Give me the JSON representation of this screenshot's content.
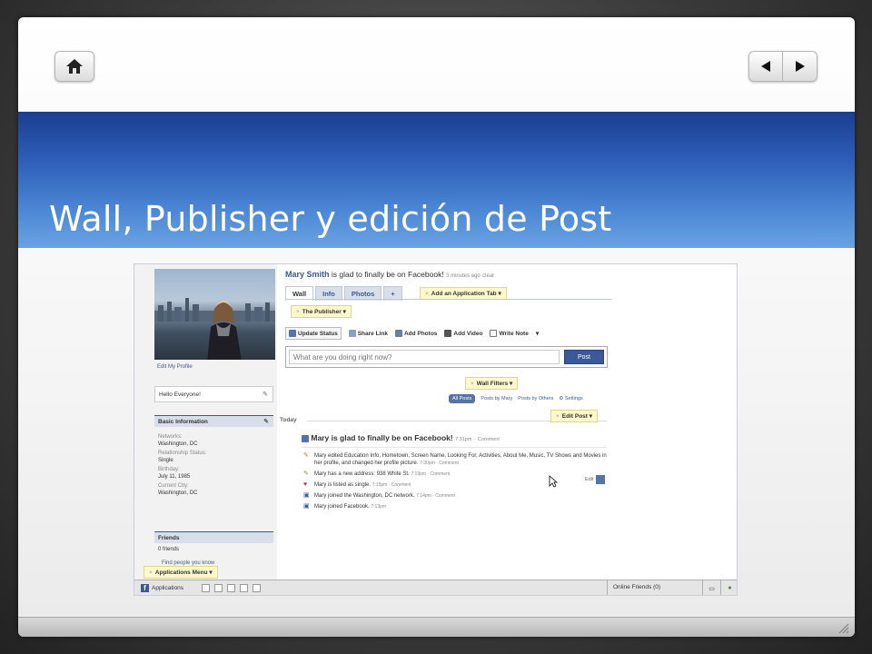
{
  "slide": {
    "title": "Wall, Publisher y edición de Post",
    "home_icon": "home-icon",
    "prev_icon": "triangle-left-icon",
    "next_icon": "triangle-right-icon"
  },
  "facebook": {
    "profile": {
      "edit_profile": "Edit My Profile",
      "status_text": "Hello Everyone!",
      "basic_info_title": "Basic Information",
      "info": [
        {
          "label": "Networks:",
          "value": "Washington, DC"
        },
        {
          "label": "Relationship Status:",
          "value": "Single"
        },
        {
          "label": "Birthday:",
          "value": "July 11, 1985"
        },
        {
          "label": "Current City:",
          "value": "Washington, DC"
        }
      ],
      "friends_title": "Friends",
      "friends_count": "0 friends",
      "find_people": "Find people you know"
    },
    "header": {
      "name": "Mary Smith",
      "status": "is glad to finally be on Facebook!",
      "time": "3 minutes ago",
      "clear": "clear"
    },
    "tabs": [
      "Wall",
      "Info",
      "Photos",
      "+"
    ],
    "add_tab": "Add an Application Tab",
    "publisher_tab": "The Publisher",
    "actions": [
      "Update Status",
      "Share Link",
      "Add Photos",
      "Add Video",
      "Write Note"
    ],
    "publisher": {
      "placeholder": "What are you doing right now?",
      "post_label": "Post"
    },
    "wall_filters": "Wall Filters",
    "filters": [
      "All Posts",
      "Posts by Mary",
      "Posts by Others",
      "Settings"
    ],
    "today": "Today",
    "edit_post": "Edit Post",
    "main_story": {
      "text": "Mary is glad to finally be on Facebook!",
      "time": "7:31pm",
      "comment": "Comment"
    },
    "feed": [
      {
        "text": "Mary edited Education Info, Hometown, Screen Name, Looking For, Activities, About Me, Music, TV Shows and Movies in her profile, and changed her profile picture.",
        "meta": "7:30pm · Comment"
      },
      {
        "text": "Mary has a new address: 938 White St.",
        "meta": "7:19pm · Comment"
      },
      {
        "text": "Mary is listed as single.",
        "meta": "7:15pm · Comment"
      },
      {
        "text": "Mary joined the Washington, DC network.",
        "meta": "7:14pm · Comment"
      },
      {
        "text": "Mary joined Facebook.",
        "meta": "7:13pm"
      }
    ],
    "edit_label": "Edit",
    "applications_menu": "Applications Menu",
    "taskbar": {
      "applications": "Applications",
      "online_friends": "Online Friends (0)"
    }
  }
}
